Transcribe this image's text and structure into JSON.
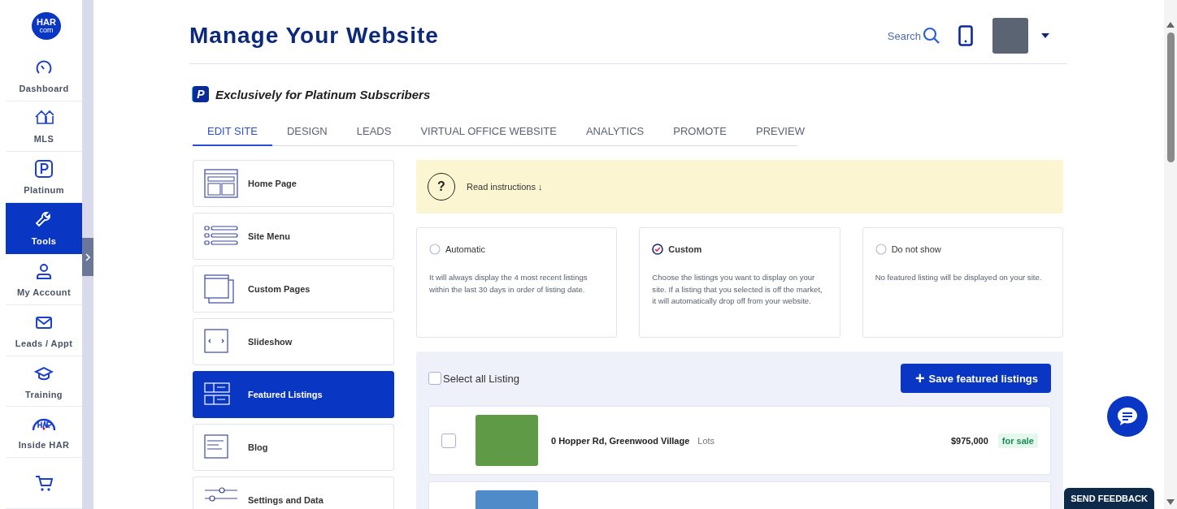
{
  "logo": {
    "line1": "HAR",
    "line2": "com"
  },
  "sidebar": {
    "items": [
      {
        "label": "Dashboard",
        "selected": false
      },
      {
        "label": "MLS",
        "selected": false
      },
      {
        "label": "Platinum",
        "selected": false
      },
      {
        "label": "Tools",
        "selected": true
      },
      {
        "label": "My Account",
        "selected": false
      },
      {
        "label": "Leads / Appt",
        "selected": false
      },
      {
        "label": "Training",
        "selected": false
      },
      {
        "label": "Inside HAR",
        "selected": false
      },
      {
        "selected": false
      }
    ]
  },
  "header": {
    "title": "Manage Your Website",
    "search_label": "Search"
  },
  "subscription": {
    "badge": "P",
    "text": "Exclusively for Platinum Subscribers"
  },
  "tabs": [
    {
      "label": "EDIT SITE",
      "selected": true
    },
    {
      "label": "DESIGN",
      "selected": false
    },
    {
      "label": "LEADS",
      "selected": false
    },
    {
      "label": "VIRTUAL OFFICE WEBSITE",
      "selected": false
    },
    {
      "label": "ANALYTICS",
      "selected": false
    },
    {
      "label": "PROMOTE",
      "selected": false
    },
    {
      "label": "PREVIEW",
      "selected": false
    }
  ],
  "site_menu": [
    {
      "label": "Home Page",
      "selected": false
    },
    {
      "label": "Site Menu",
      "selected": false
    },
    {
      "label": "Custom Pages",
      "selected": false
    },
    {
      "label": "Slideshow",
      "selected": false
    },
    {
      "label": "Featured Listings",
      "selected": true
    },
    {
      "label": "Blog",
      "selected": false
    },
    {
      "label": "Settings and Data",
      "selected": false
    }
  ],
  "instructions": {
    "icon_text": "?",
    "text": "Read instructions ↓"
  },
  "options": [
    {
      "label": "Automatic",
      "selected": false,
      "description": "It will always display the 4 most recent listings within the last 30 days in order of listing date."
    },
    {
      "label": "Custom",
      "selected": true,
      "description": "Choose the listings you want to display on your site. If a listing that you selected is off the market, it will automatically drop off from your website."
    },
    {
      "label": "Do not show",
      "selected": false,
      "description": "No featured listing will be displayed on your site."
    }
  ],
  "listing_panel": {
    "select_all": {
      "label": "Select all Listing",
      "checked": false
    },
    "save_button": {
      "icon_text": "+",
      "label": "Save featured listings"
    }
  },
  "listings": [
    {
      "kind": "full",
      "checked": false,
      "address": "0 Hopper Rd, Greenwood Village",
      "type": "Lots",
      "price": "$975,000",
      "status": "for sale"
    },
    {
      "kind": "cut"
    }
  ],
  "feedback_button": "SEND FEEDBACK"
}
